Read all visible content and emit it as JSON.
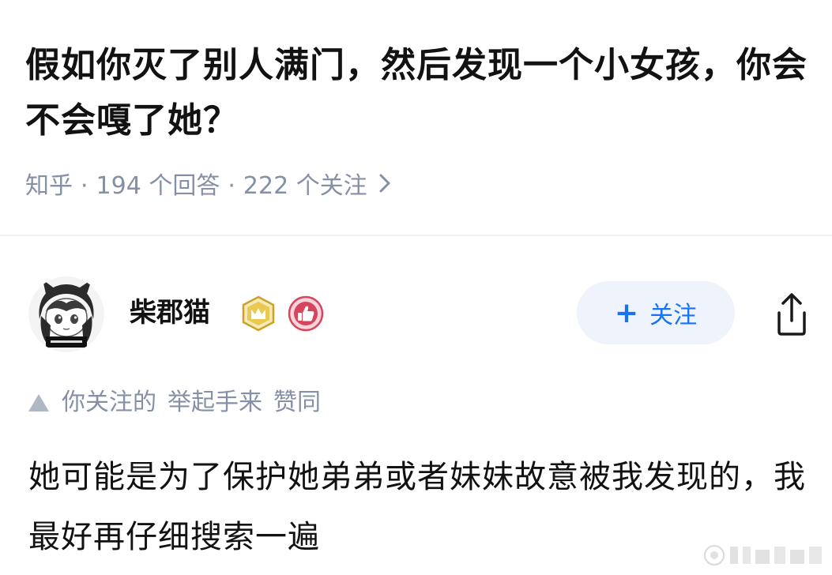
{
  "question": {
    "title": "假如你灭了别人满门，然后发现一个小女孩，你会不会嘎了她？",
    "source": "知乎",
    "answers": "194 个回答",
    "followers": "222 个关注",
    "separator": "·",
    "chevron_icon": "chevron-right-icon"
  },
  "author": {
    "name": "柴郡猫",
    "level_badge_icon": "level-crown-badge-icon",
    "like_badge_icon": "thumbs-up-badge-icon",
    "follow_plus": "+",
    "follow_label": "关注",
    "share_icon": "share-icon"
  },
  "endorsement": {
    "prefix": "你关注的",
    "user": "举起手来",
    "action": "赞同"
  },
  "answer": {
    "text": "她可能是为了保护她弟弟或者妹妹故意被我发现的，我最好再仔细搜索一遍"
  },
  "colors": {
    "meta_gray": "#8590a6",
    "follow_blue": "#1772f6",
    "follow_bg": "#eef3fc",
    "badge_gold": "#c9a227",
    "badge_red": "#d6455d"
  }
}
